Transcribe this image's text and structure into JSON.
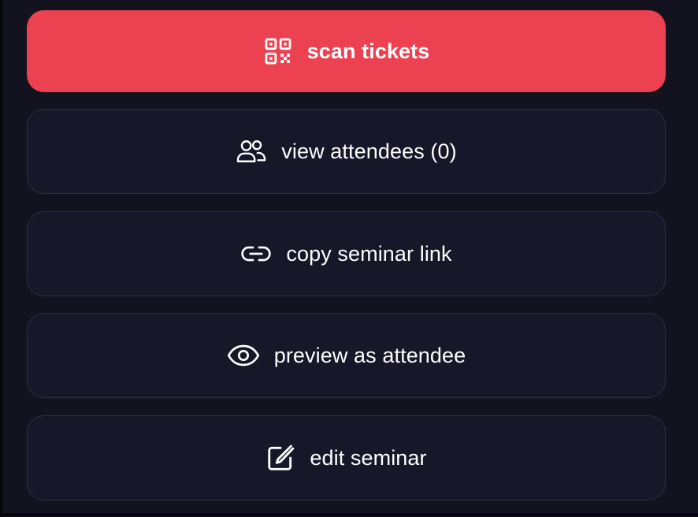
{
  "actions": [
    {
      "label": "scan tickets",
      "icon": "qr-code-icon",
      "style": "primary"
    },
    {
      "label": "view attendees (0)",
      "icon": "users-icon",
      "style": "outline"
    },
    {
      "label": "copy seminar link",
      "icon": "link-icon",
      "style": "outline"
    },
    {
      "label": "preview as attendee",
      "icon": "eye-icon",
      "style": "outline"
    },
    {
      "label": "edit seminar",
      "icon": "edit-icon",
      "style": "outline"
    }
  ],
  "colors": {
    "background": "#13131f",
    "primary": "#ec4150",
    "card": "#161728",
    "border": "#2e3042",
    "text": "#ffffff"
  }
}
